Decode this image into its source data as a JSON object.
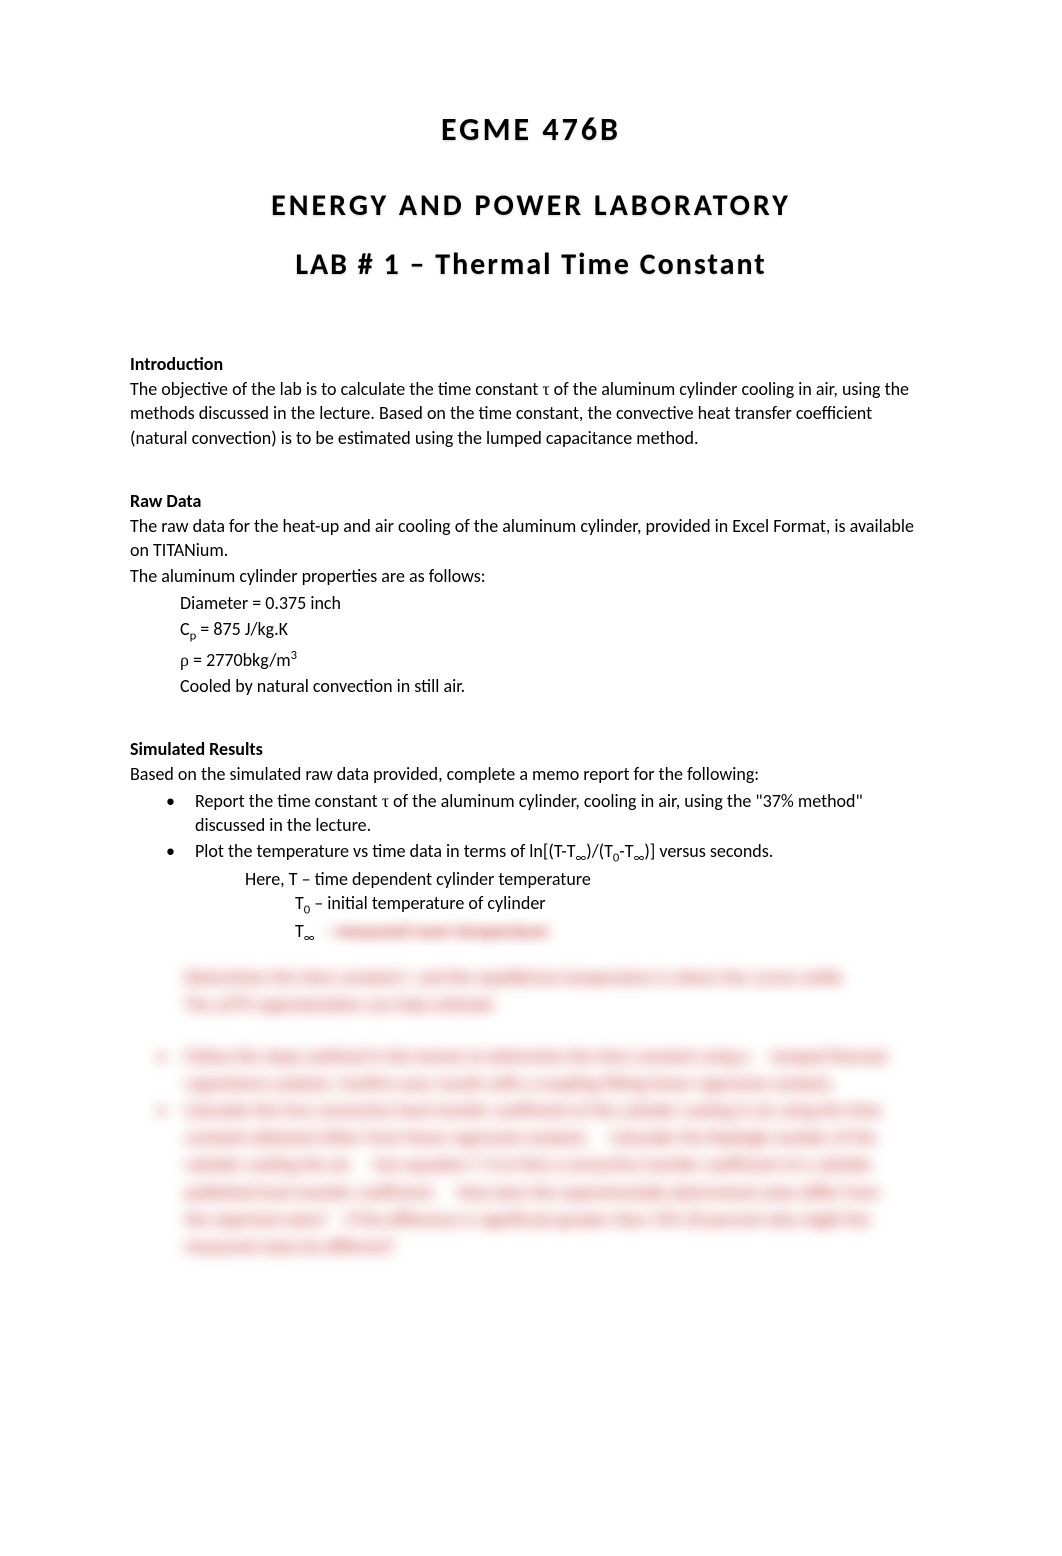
{
  "header": {
    "course": "EGME  476B",
    "lab_title": "ENERGY  AND  POWER  LABORATORY",
    "lab_number": "LAB  # 1 – Thermal  Time  Constant"
  },
  "introduction": {
    "heading": "Introduction",
    "text": "The objective of the lab is to calculate the time constant τ of the aluminum cylinder cooling in air, using the methods discussed in the lecture.  Based on the time constant, the convective heat transfer coefficient (natural convection) is to be estimated using the lumped capacitance method."
  },
  "raw_data": {
    "heading": "Raw Data",
    "intro": "The raw data for the heat-up and air cooling of the aluminum cylinder, provided in Excel Format, is available on TITANium.",
    "props_intro": "The aluminum cylinder properties are as follows:",
    "diameter": "Diameter  =  0.375 inch",
    "cp_label": "C",
    "cp_sub": "p",
    "cp_value": "  = 875 J/kg.K",
    "rho_label": "ρ",
    "rho_value": "   =  2770bkg/m",
    "rho_sup": "3",
    "cooled": "Cooled by natural convection in still air."
  },
  "simulated": {
    "heading": "Simulated Results",
    "intro": "Based on the simulated raw data provided, complete a memo report for the following:",
    "bullet1": "Report the time constant τ of the aluminum cylinder, cooling in air, using the \"37% method\" discussed in the lecture.",
    "bullet2_main": "Plot the temperature vs time data in terms of ln[(T-T∞)/(T0-T∞)]  versus seconds.",
    "bullet2_sub1": "Here,  T – time dependent cylinder temperature",
    "bullet2_sub2_label": "T",
    "bullet2_sub2_sub": "0",
    "bullet2_sub2_text": " – initial temperature of cylinder",
    "bullet2_sub3_label": "T",
    "bullet2_sub3_sub": "∞",
    "bullet2_sub3_blur": "– measured room temperature"
  },
  "blurred": {
    "para1_l1": "Determines the time constant t. and the equilibrium temperature is where the curves settle",
    "para1_l2": "The a37% approximation can help estimate",
    "b1_l1": "Follow the steps outlined in the lecture to determine the time constant using a",
    "b1_l1b": "lumped thermal",
    "b1_l2": "capacitance analysis.  Confirm your results with a coupling fitting linear regression analysis.",
    "b2_l1": "Calculate the free convective heat transfer coefficient of the cylinder cooling in air using the time",
    "b2_l2": "constant obtained either from linear regression analysis.",
    "b2_l2b": "Calculate the Rayleigh number of the",
    "b2_l3": "cylinder cooling the air.",
    "b2_l3b": "Use equation 7.3 to find a convective transfer coefficient of a cylinder",
    "b2_l4": "published heat transfer coefficient.",
    "b2_l4b": "How does the experimentally determined value differ from",
    "b2_l5": "the expected value?",
    "b2_l5b": "If the difference is significant greater than 15% 20 percent why might the",
    "b2_l6": "measured value be different?"
  }
}
